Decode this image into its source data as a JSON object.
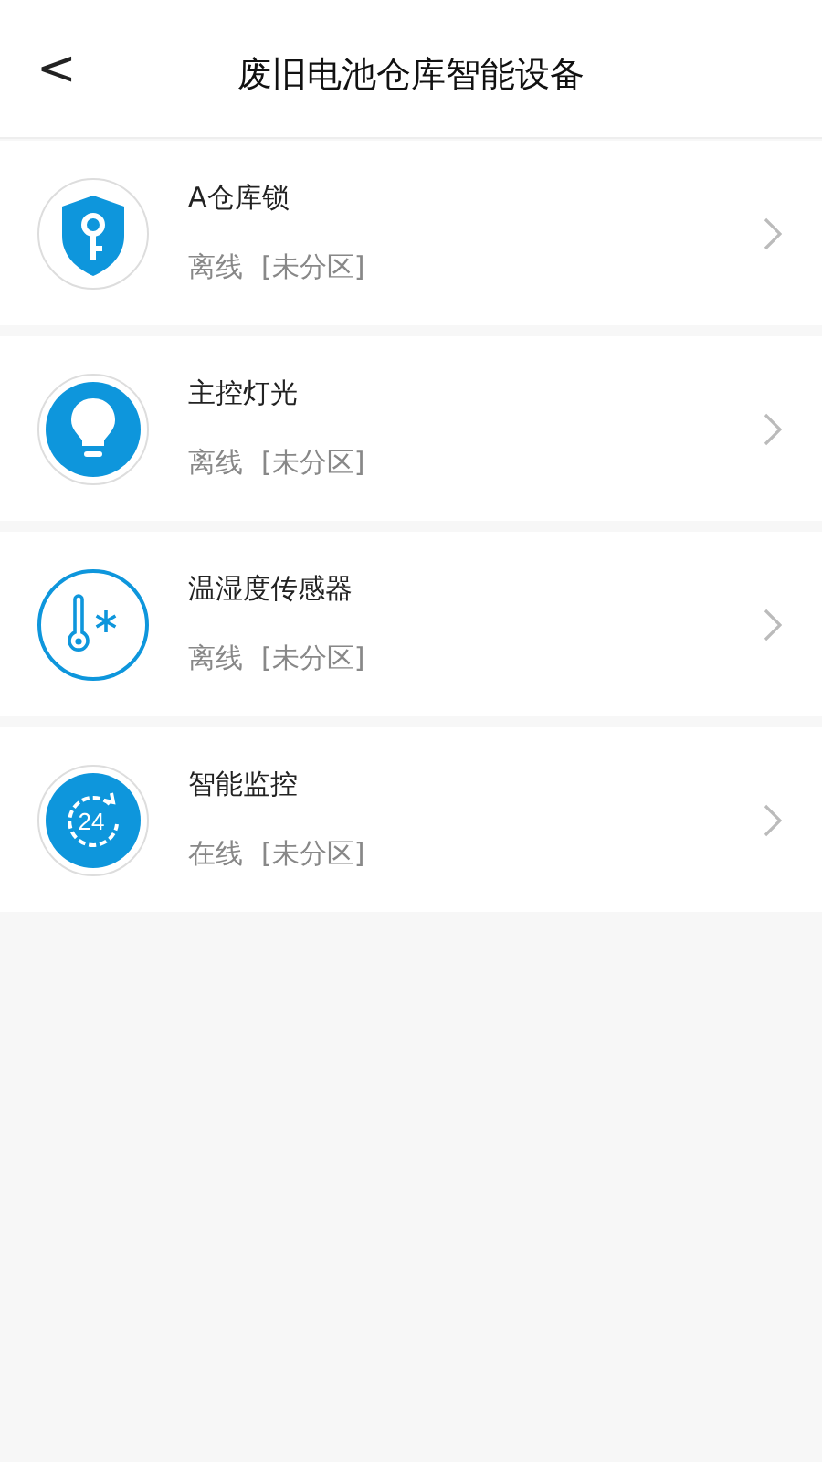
{
  "header": {
    "back": "<",
    "title": "废旧电池仓库智能设备"
  },
  "devices": [
    {
      "kind": "lock",
      "name": "A仓库锁",
      "status": "离线",
      "zone": "[未分区]"
    },
    {
      "kind": "bulb",
      "name": "主控灯光",
      "status": "离线",
      "zone": "[未分区]"
    },
    {
      "kind": "sensor",
      "name": "温湿度传感器",
      "status": "离线",
      "zone": "[未分区]"
    },
    {
      "kind": "monitor",
      "name": "智能监控",
      "status": "在线",
      "zone": "[未分区]",
      "icon_label": "24"
    }
  ]
}
